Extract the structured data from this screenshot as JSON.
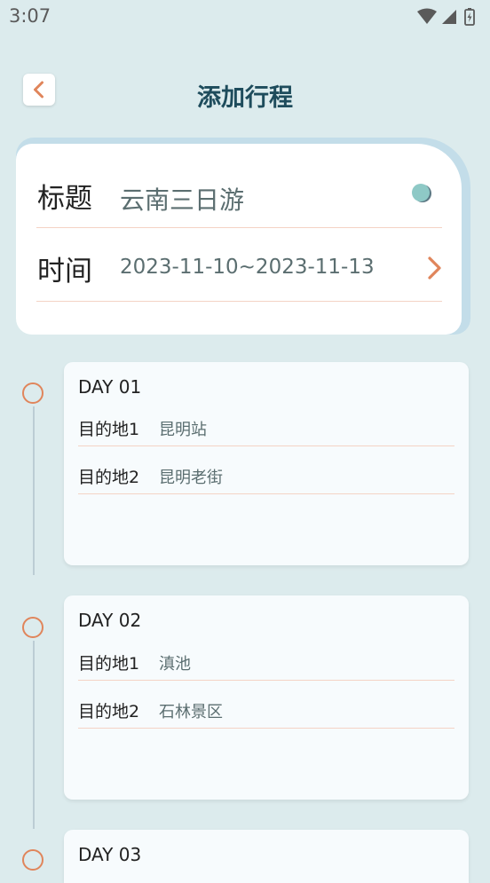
{
  "status": {
    "time": "3:07"
  },
  "header": {
    "title": "添加行程"
  },
  "info": {
    "title_label": "标题",
    "title_value": "云南三日游",
    "time_label": "时间",
    "time_value": "2023-11-10~2023-11-13"
  },
  "days": [
    {
      "title": "DAY 01",
      "destinations": [
        {
          "label": "目的地1",
          "value": "昆明站"
        },
        {
          "label": "目的地2",
          "value": "昆明老街"
        }
      ]
    },
    {
      "title": "DAY 02",
      "destinations": [
        {
          "label": "目的地1",
          "value": "滇池"
        },
        {
          "label": "目的地2",
          "value": "石林景区"
        }
      ]
    },
    {
      "title": "DAY 03"
    }
  ],
  "colors": {
    "accent": "#e0855b",
    "title": "#1e4c5c",
    "background": "#dcebed"
  }
}
